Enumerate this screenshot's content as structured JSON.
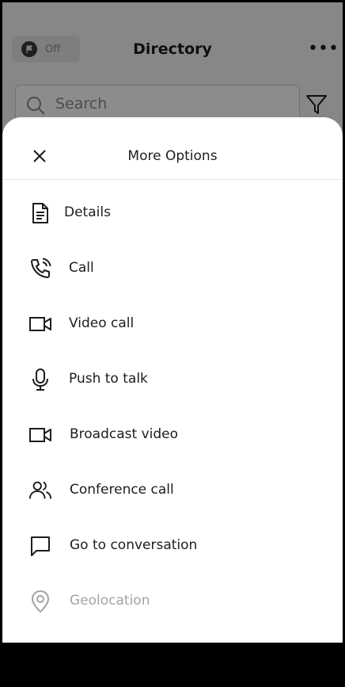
{
  "header": {
    "off_label": "Off",
    "title": "Directory",
    "more_label": "•••"
  },
  "search": {
    "placeholder": "Search"
  },
  "sheet": {
    "title": "More Options",
    "items": [
      {
        "label": "Details",
        "icon": "document-icon",
        "enabled": true
      },
      {
        "label": "Call",
        "icon": "phone-icon",
        "enabled": true
      },
      {
        "label": "Video call",
        "icon": "video-camera-icon",
        "enabled": true
      },
      {
        "label": "Push to talk",
        "icon": "microphone-icon",
        "enabled": true
      },
      {
        "label": "Broadcast video",
        "icon": "video-camera-icon",
        "enabled": true
      },
      {
        "label": "Conference call",
        "icon": "users-icon",
        "enabled": true
      },
      {
        "label": "Go to conversation",
        "icon": "chat-bubble-icon",
        "enabled": true
      },
      {
        "label": "Geolocation",
        "icon": "location-pin-icon",
        "enabled": false
      }
    ]
  },
  "colors": {
    "text": "#1d1d1d",
    "disabled_text": "#a3a3a3",
    "overlay": "#000000"
  }
}
